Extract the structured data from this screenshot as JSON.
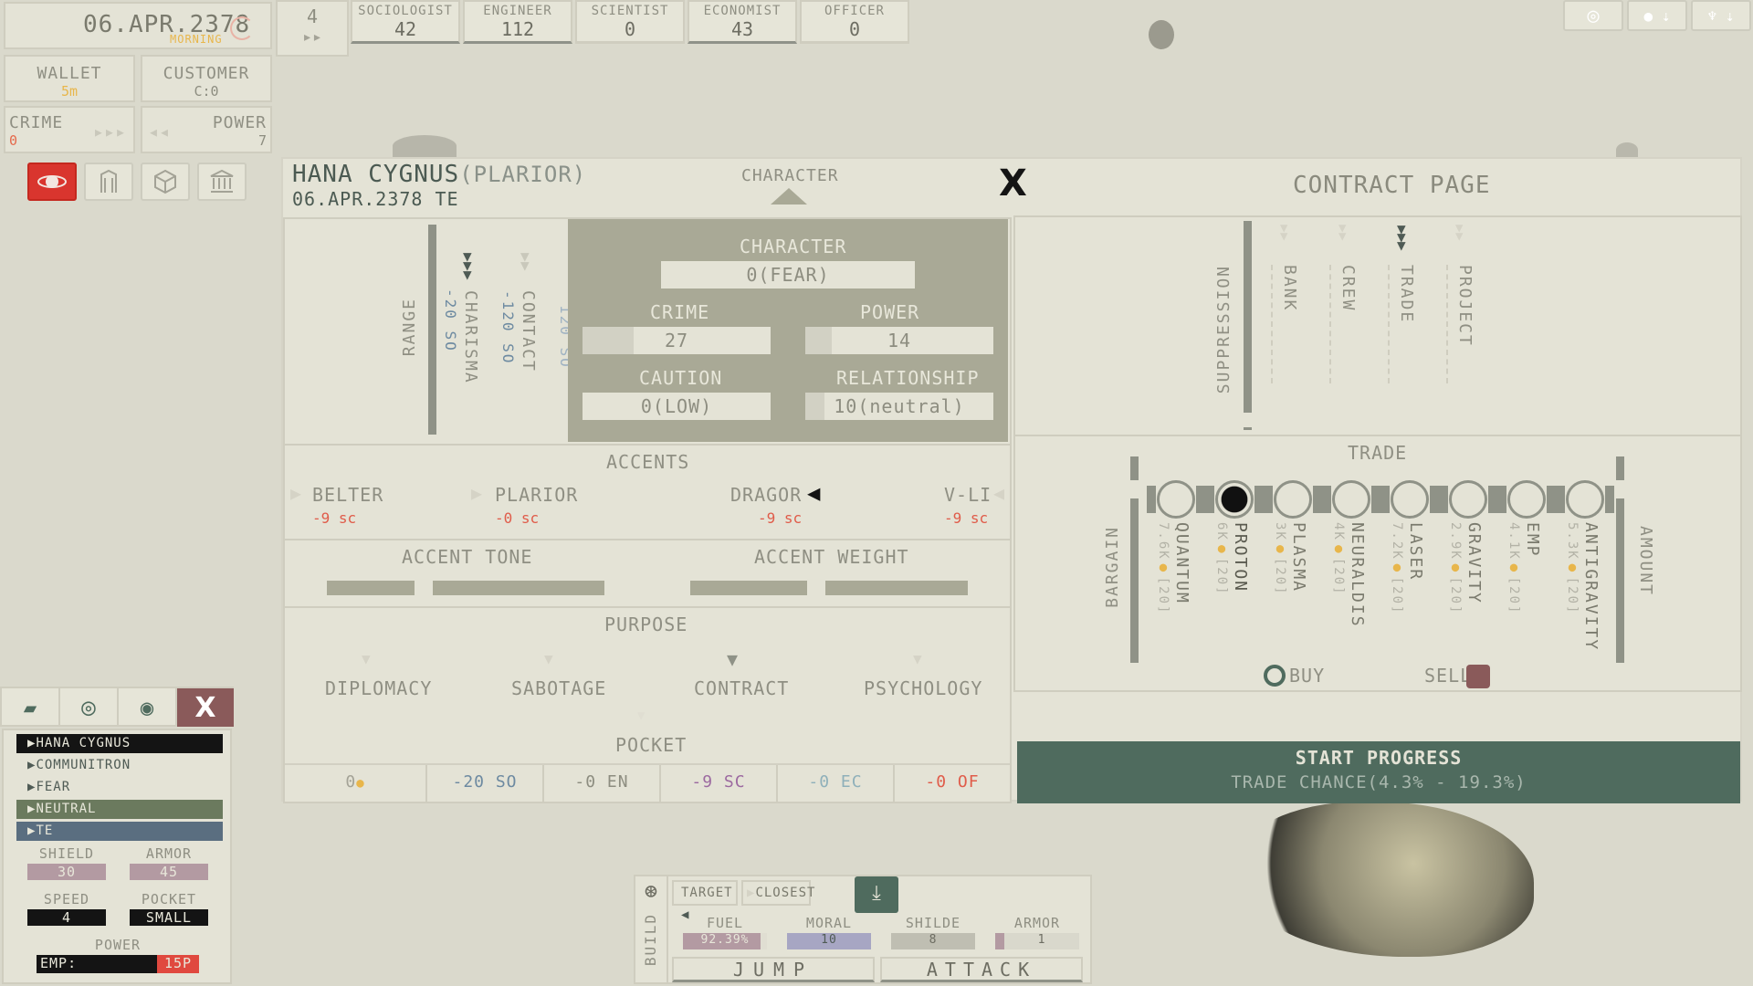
{
  "top_left": {
    "date": "06.APR.2378",
    "time_of_day": "MORNING",
    "wallet_label": "WALLET",
    "wallet_value": "5m",
    "customer_label": "CUSTOMER",
    "customer_value": "C:0",
    "crime_label": "CRIME",
    "crime_value": "0",
    "power_label": "POWER",
    "power_value": "7",
    "speed_counter": "4"
  },
  "population": [
    {
      "label": "SOCIOLOGIST",
      "value": "42"
    },
    {
      "label": "ENGINEER",
      "value": "112"
    },
    {
      "label": "SCIENTIST",
      "value": "0"
    },
    {
      "label": "ECONOMIST",
      "value": "43"
    },
    {
      "label": "OFFICER",
      "value": "0"
    }
  ],
  "header": {
    "name": "HANA CYGNUS",
    "faction": "(PLARIOR)",
    "date": "06.APR.2378",
    "era": "TE",
    "tab_character": "CHARACTER",
    "close": "X",
    "contract_title": "CONTRACT PAGE"
  },
  "range": {
    "label": "RANGE",
    "charisma_label": "CHARISMA",
    "charisma_value": "-20 SO",
    "contact_label": "CONTACT",
    "contact_value": "-120 SO",
    "extra_value": "120 SO"
  },
  "character": {
    "title": "CHARACTER",
    "trait": "0(FEAR)",
    "crime_label": "CRIME",
    "crime_value": "27",
    "crime_fill": 0.27,
    "power_label": "POWER",
    "power_value": "14",
    "power_fill": 0.14,
    "caution_label": "CAUTION",
    "caution_value": "0(LOW)",
    "relationship_label": "RELATIONSHIP",
    "relationship_value": "10(neutral)",
    "relationship_fill": 0.1
  },
  "accents": {
    "title": "ACCENTS",
    "items": [
      {
        "name": "BELTER",
        "value": "-9 sc"
      },
      {
        "name": "PLARIOR",
        "value": "-0 sc"
      },
      {
        "name": "DRAGOR",
        "value": "-9 sc"
      },
      {
        "name": "V-LI",
        "value": "-9 sc"
      }
    ],
    "tone_label": "ACCENT TONE",
    "weight_label": "ACCENT WEIGHT"
  },
  "purpose": {
    "title": "PURPOSE",
    "items": [
      "DIPLOMACY",
      "SABOTAGE",
      "CONTRACT",
      "PSYCHOLOGY"
    ],
    "pocket_label": "POCKET",
    "pocket_values": [
      "0",
      "-20 SO",
      "-0 EN",
      "-9 SC",
      "-0 EC",
      "-0 OF"
    ]
  },
  "contract": {
    "suppression_label": "SUPPRESSION",
    "categories": [
      "BANK",
      "CREW",
      "TRADE",
      "PROJECT"
    ],
    "trade_title": "TRADE",
    "bargain_label": "BARGAIN",
    "amount_label": "AMOUNT",
    "goods": [
      {
        "name": "QUANTUM",
        "price": "7.6k",
        "qty": "[20]"
      },
      {
        "name": "PROTON",
        "price": "6k",
        "qty": "[20]"
      },
      {
        "name": "PLASMA",
        "price": "3k",
        "qty": "[20]"
      },
      {
        "name": "NEURALDIS",
        "price": "4k",
        "qty": "[20]"
      },
      {
        "name": "LASER",
        "price": "7.2k",
        "qty": "[20]"
      },
      {
        "name": "GRAVITY",
        "price": "2.9k",
        "qty": "[20]"
      },
      {
        "name": "EMP",
        "price": "4.1k",
        "qty": "[20]"
      },
      {
        "name": "ANTIGRAVITY",
        "price": "5.3k",
        "qty": "[20]"
      }
    ],
    "buy_label": "BUY",
    "sell_label": "SELL",
    "start_label": "START PROGRESS",
    "chance_label": "TRADE CHANCE(4.3% - 19.3%)"
  },
  "left_list": {
    "close": "X",
    "items": [
      "HANA CYGNUS",
      "COMMUNITRON",
      "FEAR",
      "NEUTRAL",
      "TE"
    ],
    "shield_label": "SHIELD",
    "shield_value": "30",
    "armor_label": "ARMOR",
    "armor_value": "45",
    "speed_label": "SPEED",
    "speed_value": "4",
    "pocket_label": "POCKET",
    "pocket_value": "SMALL",
    "power_label": "POWER",
    "emp_label": "EMP:",
    "emp_value": "15P"
  },
  "bottom_bar": {
    "build_label": "BUILD",
    "target_label": "TARGET",
    "closest_label": "CLOSEST",
    "fuel_label": "FUEL",
    "fuel_value": "92.39%",
    "fuel_fill": 0.9239,
    "moral_label": "MORAL",
    "moral_value": "10",
    "shilde_label": "SHILDE",
    "shilde_value": "8",
    "armor_label": "ARMOR",
    "armor_value": "1",
    "jump_label": "JUMP",
    "attack_label": "ATTACK"
  },
  "colors": {
    "accent_green": "#4f6b5e",
    "accent_red": "#d9352e",
    "gold": "#e8b64b",
    "character_bg": "#a9a996"
  }
}
